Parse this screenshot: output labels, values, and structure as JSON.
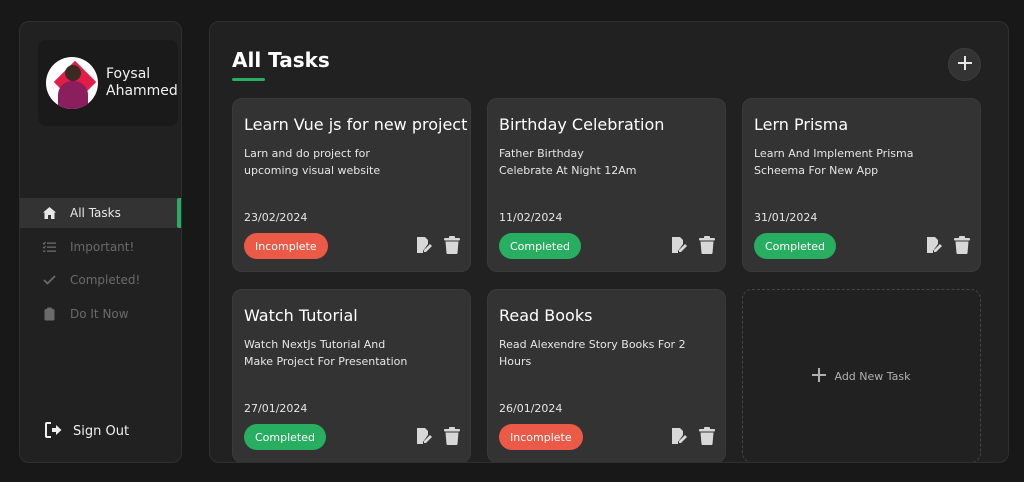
{
  "user": {
    "first_name": "Foysal",
    "last_name": "Ahammed"
  },
  "nav": [
    {
      "label": "All Tasks",
      "icon": "home-icon",
      "active": true
    },
    {
      "label": "Important!",
      "icon": "list-check-icon",
      "active": false
    },
    {
      "label": "Completed!",
      "icon": "check-icon",
      "active": false
    },
    {
      "label": "Do It Now",
      "icon": "clipboard-icon",
      "active": false
    }
  ],
  "sign_out": {
    "label": "Sign Out",
    "icon": "sign-out-icon"
  },
  "main": {
    "title": "All Tasks"
  },
  "tasks": [
    {
      "title": "Learn Vue js for new project",
      "desc_line1": "Larn and do project for",
      "desc_line2": "upcoming visual website",
      "date": "23/02/2024",
      "status": "Incomplete"
    },
    {
      "title": "Birthday Celebration",
      "desc_line1": "Father Birthday",
      "desc_line2": "Celebrate At Night 12Am",
      "date": "11/02/2024",
      "status": "Completed"
    },
    {
      "title": "Lern Prisma",
      "desc_line1": "Learn And Implement Prisma",
      "desc_line2": "Scheema For New App",
      "date": "31/01/2024",
      "status": "Completed"
    },
    {
      "title": "Watch Tutorial",
      "desc_line1": "Watch NextJs Tutorial And",
      "desc_line2": "Make Project For Presentation",
      "date": "27/01/2024",
      "status": "Completed"
    },
    {
      "title": "Read Books",
      "desc_line1": "Read Alexendre Story Books For 2 Hours",
      "desc_line2": "",
      "date": "26/01/2024",
      "status": "Incomplete"
    }
  ],
  "add_task": {
    "label": "Add New Task"
  },
  "colors": {
    "accent": "#27ae60",
    "incomplete": "#eb5a46",
    "completed": "#27ae60",
    "card": "#333333",
    "panel": "#212121",
    "background": "#181818"
  }
}
